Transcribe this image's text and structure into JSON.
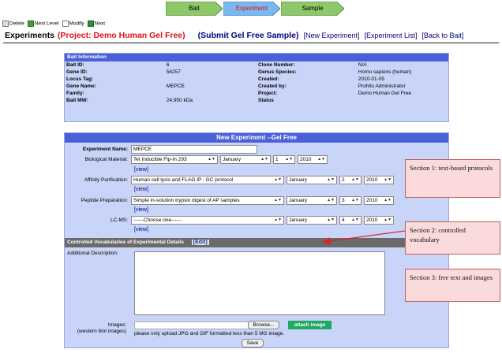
{
  "workflow": {
    "steps": [
      "Bait",
      "Experiment",
      "Sample"
    ],
    "active": "Experiment",
    "colors": {
      "inactive": "#8ec86a",
      "active": "#7ab8f0",
      "active_text": "#e01010"
    }
  },
  "legend": {
    "delete": "Delete",
    "next_level": "Next Level",
    "modify": "Modify",
    "next": "Next"
  },
  "title": {
    "experiments": "Experiments",
    "project": "(Project: Demo Human Gel Free)",
    "submit": "(Submit Gel Free Sample)",
    "links": [
      "[New Experiment]",
      "[Experiment List]",
      "[Back to Bait]"
    ]
  },
  "bait_info": {
    "header": "Bait Information",
    "rows": [
      {
        "k1": "Bait ID:",
        "v1": "6",
        "k2": "Clone Number:",
        "v2": "N/A"
      },
      {
        "k1": "Gene ID:",
        "v1": "56257",
        "k2": "Genus Species:",
        "v2": "Homo sapiens (human)"
      },
      {
        "k1": "Locus Tag:",
        "v1": "",
        "k2": "Created:",
        "v2": "2010-01-05"
      },
      {
        "k1": "Gene Name:",
        "v1": "MEPCE",
        "k2": "Created by:",
        "v2": "Prohits Administrator"
      },
      {
        "k1": "Family:",
        "v1": "",
        "k2": "Project:",
        "v2": "Demo Human Gel Free"
      },
      {
        "k1": "Bait MW:",
        "v1": "24,950 kDa",
        "k2": "Status",
        "v2": ""
      }
    ],
    "pager": [
      "|<",
      "<",
      ">",
      ">|"
    ]
  },
  "form": {
    "header": "New Experiment --Gel Free",
    "experiment_name_label": "Experiment Name:",
    "experiment_name": "MEPCE",
    "biological_label": "Biological Material:",
    "biological": "Tet Inducible Flp-In 293",
    "biological_date": [
      "January",
      "1",
      "2010"
    ],
    "affinity_label": "Affinity Purification:",
    "affinity": "Human cell lysis and FLAG IP : GC protocol",
    "affinity_date": [
      "January",
      "2",
      "2010"
    ],
    "peptide_label": "Peptide Preparation:",
    "peptide": "Simple in-solution trypsin digest of AP samples",
    "peptide_date": [
      "January",
      "3",
      "2010"
    ],
    "lcms_label": "LC-MS:",
    "lcms": "------Choose one------",
    "lcms_date": [
      "January",
      "4",
      "2010"
    ],
    "view_label": "[view]",
    "cv_label": "Controlled Vocabularies of Experimental Details",
    "edit_label": "[Edit]",
    "description_label": "Additional Description:",
    "images_label": "Images:",
    "images_sub": "(western blot images)",
    "browse": "Browse...",
    "attach": "attach image",
    "upload_note": "please only upload JPG and GIF formatted less than 5 MG image.",
    "save": "Save"
  },
  "callouts": {
    "s1": "Section 1: text-based protocols",
    "s2": "Section 2: controlled vocabulary",
    "s3": "Section 3: free text and images"
  }
}
